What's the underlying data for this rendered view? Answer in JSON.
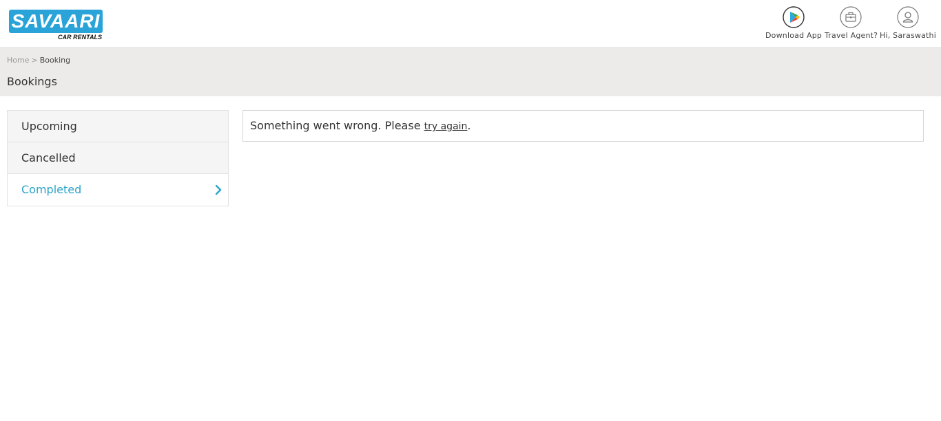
{
  "header": {
    "logo": {
      "name": "SAVAARI",
      "tagline": "CAR RENTALS"
    },
    "nav": {
      "download_label": "Download App",
      "agent_label": "Travel Agent?",
      "user_label": "Hi, Saraswathi"
    },
    "icons": [
      "play-store-icon",
      "briefcase-icon",
      "user-icon"
    ]
  },
  "breadcrumb": {
    "home": "Home",
    "separator": ">",
    "current": "Booking"
  },
  "page": {
    "title": "Bookings"
  },
  "sidebar": {
    "items": [
      {
        "label": "Upcoming",
        "active": false
      },
      {
        "label": "Cancelled",
        "active": false
      },
      {
        "label": "Completed",
        "active": true
      }
    ]
  },
  "message": {
    "prefix": "Something went wrong. Please ",
    "link": "try again",
    "suffix": "."
  },
  "colors": {
    "brand": "#2aa3d8",
    "active_text": "#2aa3c8",
    "band_bg": "#ecebea"
  }
}
